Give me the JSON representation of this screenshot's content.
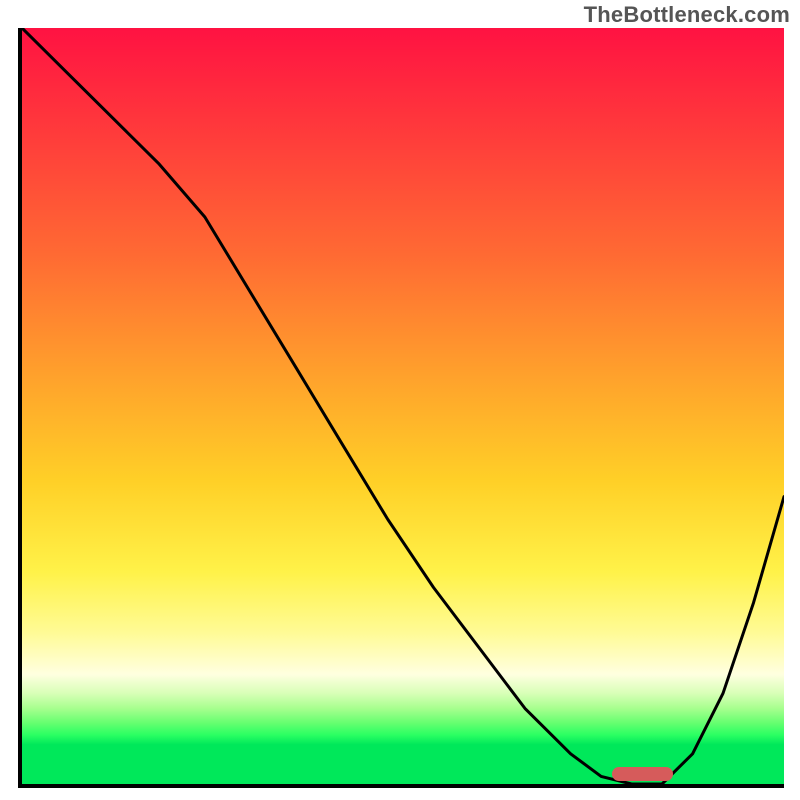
{
  "watermark": "TheBottleneck.com",
  "chart_data": {
    "type": "line",
    "title": "",
    "xlabel": "",
    "ylabel": "",
    "xlim": [
      0,
      100
    ],
    "ylim": [
      0,
      100
    ],
    "grid": false,
    "background_gradient": {
      "stops": [
        {
          "pos": 0,
          "color": "#ff1242"
        },
        {
          "pos": 14,
          "color": "#ff3b3b"
        },
        {
          "pos": 30,
          "color": "#ff6a33"
        },
        {
          "pos": 48,
          "color": "#ffa82b"
        },
        {
          "pos": 60,
          "color": "#ffd027"
        },
        {
          "pos": 72,
          "color": "#fff249"
        },
        {
          "pos": 80,
          "color": "#fffb96"
        },
        {
          "pos": 85.5,
          "color": "#ffffe0"
        },
        {
          "pos": 88,
          "color": "#d8ffb7"
        },
        {
          "pos": 90,
          "color": "#a7ff8e"
        },
        {
          "pos": 92,
          "color": "#63ff6f"
        },
        {
          "pos": 93.5,
          "color": "#2bff63"
        },
        {
          "pos": 94.8,
          "color": "#00e85a"
        },
        {
          "pos": 100,
          "color": "#00e85a"
        }
      ]
    },
    "series": [
      {
        "name": "bottleneck-curve",
        "x": [
          0,
          6,
          12,
          18,
          24,
          30,
          36,
          42,
          48,
          54,
          60,
          66,
          72,
          76,
          80,
          84,
          88,
          92,
          96,
          100
        ],
        "y": [
          100,
          94,
          88,
          82,
          75,
          65,
          55,
          45,
          35,
          26,
          18,
          10,
          4,
          1,
          0,
          0,
          4,
          12,
          24,
          38
        ],
        "color": "#000000",
        "stroke_width": 3
      }
    ],
    "marker": {
      "name": "optimal-range",
      "x_start": 77,
      "x_end": 85,
      "y": 0,
      "color": "#d65b5b"
    }
  }
}
